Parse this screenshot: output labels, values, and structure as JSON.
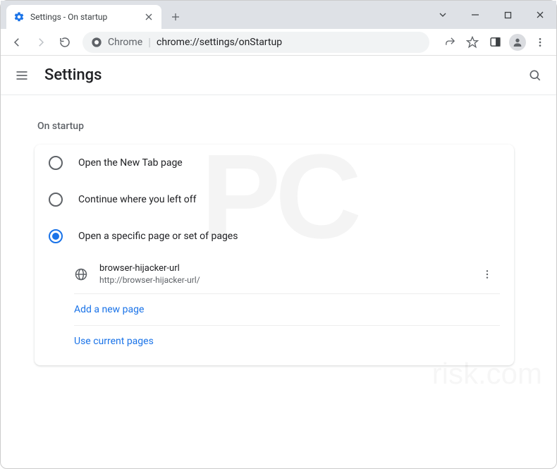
{
  "window": {
    "tab_title": "Settings - On startup"
  },
  "omnibox": {
    "origin_label": "Chrome",
    "url_path": "chrome://settings/onStartup"
  },
  "header": {
    "title": "Settings"
  },
  "section": {
    "label": "On startup",
    "options": [
      {
        "label": "Open the New Tab page",
        "checked": false
      },
      {
        "label": "Continue where you left off",
        "checked": false
      },
      {
        "label": "Open a specific page or set of pages",
        "checked": true
      }
    ],
    "pages": [
      {
        "title": "browser-hijacker-url",
        "url": "http://browser-hijacker-url/"
      }
    ],
    "actions": {
      "add_page": "Add a new page",
      "use_current": "Use current pages"
    }
  },
  "watermark": {
    "big": "PC",
    "small": "risk.com"
  }
}
